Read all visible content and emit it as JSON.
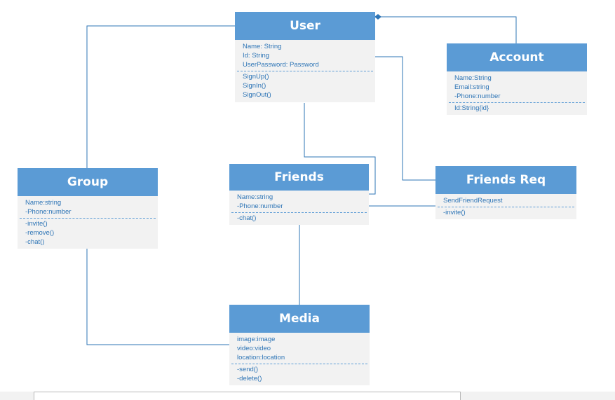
{
  "classes": {
    "user": {
      "title": "User",
      "attributes": [
        "Name: String",
        "Id: String",
        "UserPassword: Password"
      ],
      "operations": [
        "SignUp()",
        "SignIn()",
        "SignOut()"
      ]
    },
    "account": {
      "title": "Account",
      "attributes": [
        "Name:String",
        "Email:string",
        "-Phone:number"
      ],
      "operations": [
        "Id:String{id}"
      ]
    },
    "group": {
      "title": "Group",
      "attributes": [
        "Name:string",
        "-Phone:number"
      ],
      "operations": [
        "-invite()",
        "-remove()",
        "-chat()"
      ]
    },
    "friends": {
      "title": "Friends",
      "attributes": [
        "Name:string",
        "-Phone:number"
      ],
      "operations": [
        "-chat()"
      ]
    },
    "friends_req": {
      "title": "Friends Req",
      "attributes": [
        "SendFriendRequest"
      ],
      "operations": [
        "-invite()"
      ]
    },
    "media": {
      "title": "Media",
      "attributes": [
        "image:image",
        "video:video",
        "location:location"
      ],
      "operations": [
        "-send()",
        "-delete()"
      ]
    }
  },
  "colors": {
    "header": "#5b9bd5",
    "body": "#f2f2f2",
    "text": "#2e75b6",
    "connector": "#2e75b6"
  }
}
